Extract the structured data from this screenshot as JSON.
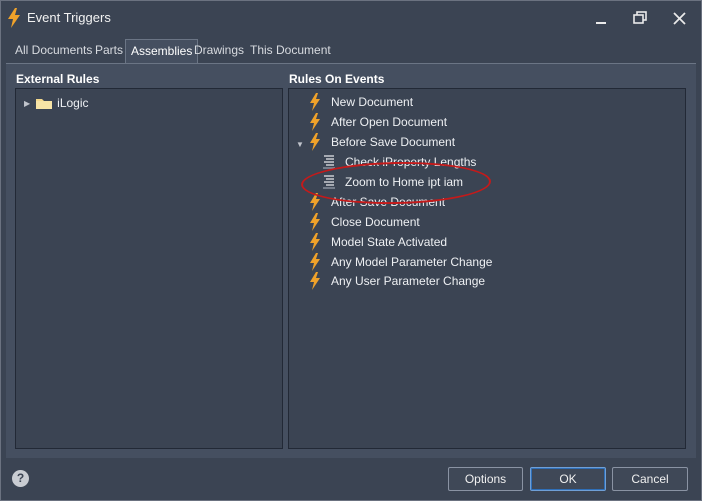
{
  "window": {
    "title": "Event Triggers"
  },
  "tabs": [
    {
      "label": "All Documents"
    },
    {
      "label": "Parts"
    },
    {
      "label": "Assemblies",
      "active": true
    },
    {
      "label": "Drawings"
    },
    {
      "label": "This Document"
    }
  ],
  "external_rules": {
    "header": "External Rules",
    "items": [
      {
        "label": "iLogic",
        "icon": "folder-icon",
        "collapsed": true
      }
    ]
  },
  "rules_on_events": {
    "header": "Rules On Events",
    "events": [
      {
        "label": "New Document",
        "icon": "bolt-icon"
      },
      {
        "label": "After Open Document",
        "icon": "bolt-icon"
      },
      {
        "label": "Before Save Document",
        "icon": "bolt-icon",
        "expanded": true,
        "rules": [
          {
            "label": "Check  iProperty Lengths",
            "icon": "rule-script-icon"
          },
          {
            "label": "Zoom to Home ipt iam",
            "icon": "rule-script-icon"
          }
        ]
      },
      {
        "label": "After Save Document",
        "icon": "bolt-icon"
      },
      {
        "label": "Close Document",
        "icon": "bolt-icon"
      },
      {
        "label": "Model State Activated",
        "icon": "bolt-icon"
      },
      {
        "label": "Any Model Parameter Change",
        "icon": "bolt-icon"
      },
      {
        "label": "Any User Parameter Change",
        "icon": "bolt-icon"
      }
    ]
  },
  "footer": {
    "help_glyph": "?",
    "options_label": "Options",
    "ok_label": "OK",
    "cancel_label": "Cancel"
  },
  "colors": {
    "bolt": "#f0a22a",
    "annotation": "#c41a1a",
    "accent": "#2f6fb8"
  }
}
